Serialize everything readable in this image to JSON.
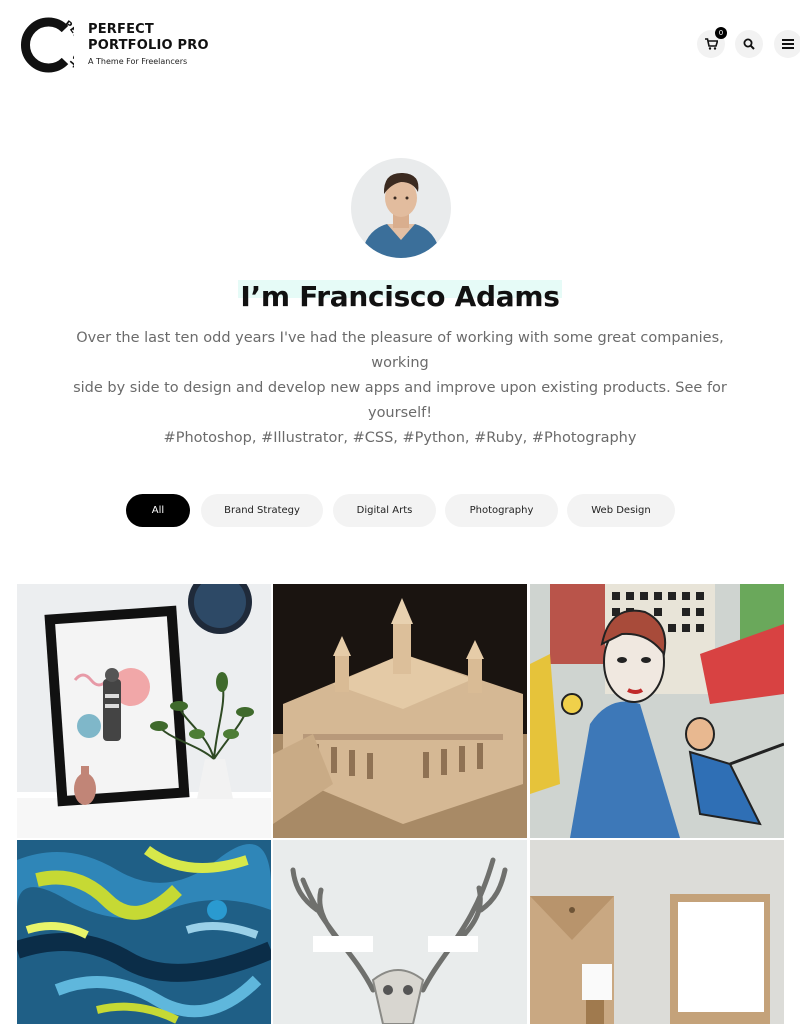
{
  "header": {
    "brand_title": "PERFECT PORTFOLIO PRO",
    "brand_tagline": "A Theme For Freelancers",
    "logo_text": "PERFECT",
    "cart_count": "0",
    "icons": [
      "cart-icon",
      "search-icon",
      "menu-icon"
    ]
  },
  "hero": {
    "title": "I’m Francisco Adams",
    "intro_line1": "Over the last ten odd years I've had the pleasure of working with some great companies, working",
    "intro_line2": "side by side to design and develop new apps and improve upon existing products. See for yourself!",
    "intro_line3": "#Photoshop, #Illustrator, #CSS, #Python, #Ruby, #Photography",
    "highlight_color": "#e6fbf7"
  },
  "filters": {
    "items": [
      "All",
      "Brand Strategy",
      "Digital Arts",
      "Photography",
      "Web Design"
    ],
    "active": "All"
  },
  "gallery": {
    "items": [
      "framed-art-with-plant",
      "architectural-model",
      "street-mural",
      "abstract-blue-paint",
      "deer-skull-antlers",
      "stationery-mockup"
    ]
  }
}
